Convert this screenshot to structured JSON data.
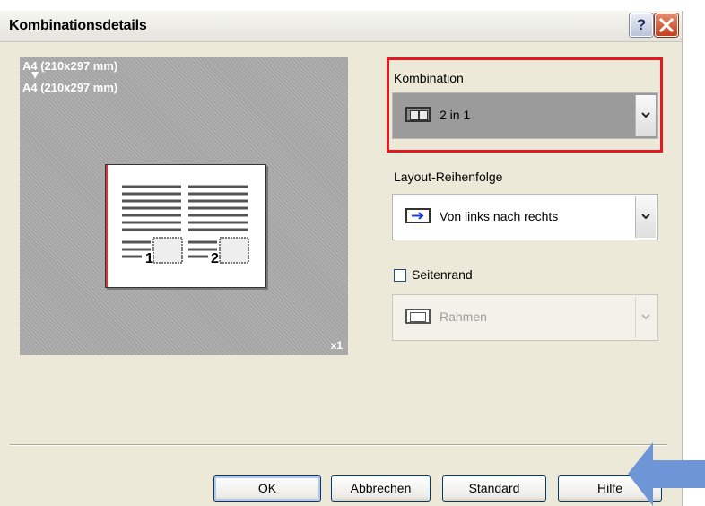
{
  "dialog": {
    "title": "Kombinationsdetails"
  },
  "preview": {
    "source_paper": "A4 (210x297 mm)",
    "target_paper": "A4 (210x297 mm)",
    "page_1": "1",
    "page_2": "2",
    "copies": "x1"
  },
  "kombination": {
    "label": "Kombination",
    "value": "2 in 1",
    "icon": "two-pages-icon"
  },
  "layout": {
    "label": "Layout-Reihenfolge",
    "value": "Von links nach rechts",
    "icon": "arrow-right-icon"
  },
  "seitenrand": {
    "label": "Seitenrand",
    "checked": false,
    "select_value": "Rahmen",
    "icon": "frame-icon"
  },
  "buttons": {
    "ok": "OK",
    "cancel": "Abbrechen",
    "standard": "Standard",
    "help": "Hilfe"
  },
  "colors": {
    "highlight": "#e21a23",
    "annotation_arrow": "#6e96d6",
    "preview_bg": "#a4a4a4"
  }
}
